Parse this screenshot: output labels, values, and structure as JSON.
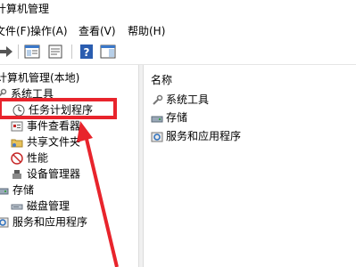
{
  "window": {
    "title": "计算机管理"
  },
  "menu": [
    "文件(F)",
    "操作(A)",
    "查看(V)",
    "帮助(H)"
  ],
  "tree": {
    "root": "计算机管理(本地)",
    "items": [
      {
        "label": "系统工具",
        "icon": "tools-icon"
      },
      {
        "label": "任务计划程序",
        "icon": "clock-icon"
      },
      {
        "label": "事件查看器",
        "icon": "event-viewer-icon"
      },
      {
        "label": "共享文件夹",
        "icon": "shared-folder-icon"
      },
      {
        "label": "性能",
        "icon": "performance-icon"
      },
      {
        "label": "设备管理器",
        "icon": "device-manager-icon"
      },
      {
        "label": "存储",
        "icon": "storage-icon"
      },
      {
        "label": "磁盘管理",
        "icon": "disk-icon"
      },
      {
        "label": "服务和应用程序",
        "icon": "services-icon"
      }
    ]
  },
  "list": {
    "header": "名称",
    "items": [
      {
        "label": "系统工具",
        "icon": "tools-icon"
      },
      {
        "label": "存储",
        "icon": "storage-icon"
      },
      {
        "label": "服务和应用程序",
        "icon": "services-icon"
      }
    ]
  },
  "colors": {
    "highlight": "#e8242c",
    "accent": "#2a6ebd"
  }
}
